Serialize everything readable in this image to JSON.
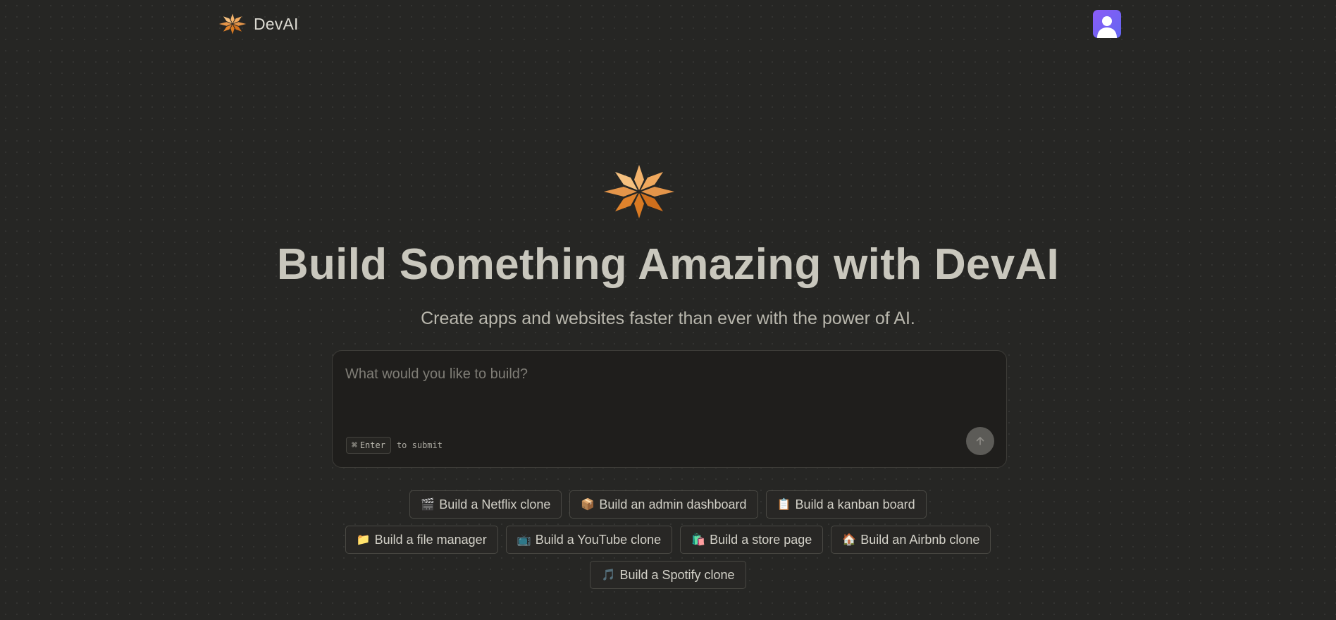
{
  "header": {
    "brand_name": "DevAI",
    "brand_logo_icon": "asterisk-star-logo-icon",
    "avatar_icon": "user-avatar-icon"
  },
  "hero": {
    "logo_icon": "asterisk-star-logo-icon",
    "title": "Build Something Amazing with DevAI",
    "subtitle": "Create apps and websites faster than ever with the power of AI."
  },
  "prompt": {
    "placeholder": "What would you like to build?",
    "value": "",
    "shortcut_symbol": "⌘",
    "shortcut_key": "Enter",
    "shortcut_hint": "to submit",
    "submit_icon": "arrow-up-icon"
  },
  "suggestions": {
    "row1": [
      {
        "icon": "🎬",
        "label": "Build a Netflix clone"
      },
      {
        "icon": "📦",
        "label": "Build an admin dashboard"
      },
      {
        "icon": "📋",
        "label": "Build a kanban board"
      }
    ],
    "row2": [
      {
        "icon": "📁",
        "label": "Build a file manager"
      },
      {
        "icon": "📺",
        "label": "Build a YouTube clone"
      },
      {
        "icon": "🛍️",
        "label": "Build a store page"
      },
      {
        "icon": "🏠",
        "label": "Build an Airbnb clone"
      }
    ],
    "row3": [
      {
        "icon": "🎵",
        "label": "Build a Spotify clone"
      }
    ]
  },
  "colors": {
    "background": "#262624",
    "logo_light": "#f2b26b",
    "logo_dark": "#d97a23",
    "avatar": "#7c5cf5"
  }
}
